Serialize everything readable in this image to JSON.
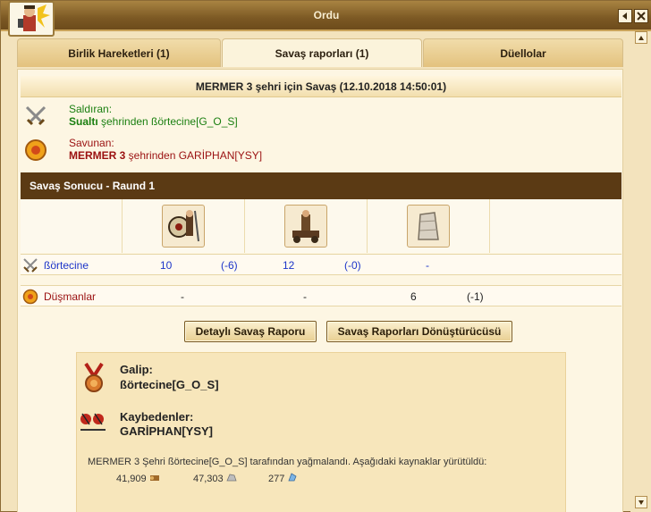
{
  "window": {
    "title": "Ordu"
  },
  "tabs": [
    {
      "label": "Birlik Hareketleri (1)"
    },
    {
      "label": "Savaş raporları (1)"
    },
    {
      "label": "Düellolar"
    }
  ],
  "report": {
    "heading": "MERMER 3 şehri için Savaş (12.10.2018 14:50:01)",
    "attacker": {
      "label": "Saldıran:",
      "city": "Sualtı",
      "rest": " şehrinden ßörtecine[G_O_S]"
    },
    "defender": {
      "label": "Savunan:",
      "city": "MERMER 3",
      "rest": " şehrinden GARİPHAN[YSY]"
    },
    "result_title": "Savaş Sonucu - Raund 1",
    "rows": [
      {
        "name": "ßörtecine",
        "cells": [
          [
            "10",
            "(-6)"
          ],
          [
            "12",
            "(-0)"
          ],
          [
            "-",
            ""
          ]
        ]
      },
      {
        "name": "Düşmanlar",
        "cells": [
          [
            "-",
            ""
          ],
          [
            "-",
            ""
          ],
          [
            "6",
            "(-1)"
          ]
        ]
      }
    ],
    "buttons": {
      "detail": "Detaylı Savaş Raporu",
      "converter": "Savaş Raporları Dönüştürücüsü"
    },
    "winner_label": "Galip:",
    "winner": "ßörtecine[G_O_S]",
    "losers_label": "Kaybedenler:",
    "losers": "GARİPHAN[YSY]",
    "plunder_text": "MERMER 3 Şehri ßörtecine[G_O_S] tarafından yağmalandı. Aşağıdaki kaynaklar yürütüldü:",
    "resources": [
      {
        "value": "41,909",
        "icon": "wood-icon"
      },
      {
        "value": "47,303",
        "icon": "marble-icon"
      },
      {
        "value": "277",
        "icon": "crystal-icon"
      }
    ]
  },
  "colors": {
    "header_bar": "#5b3a14",
    "attacker_green": "#1a7f10",
    "defender_red": "#9a1010",
    "unit_blue": "#1d35c9"
  }
}
